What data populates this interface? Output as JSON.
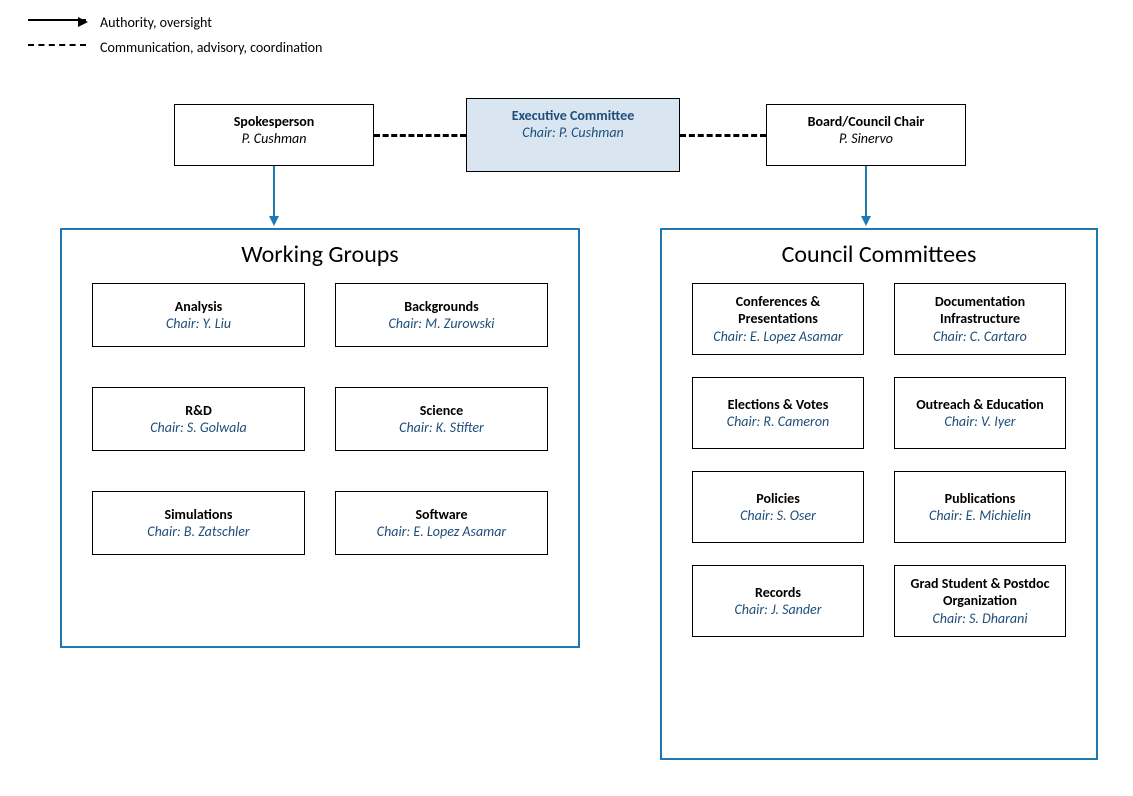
{
  "legend": {
    "solid": "Authority, oversight",
    "dashed": "Communication, advisory, coordination"
  },
  "top": {
    "spokesperson": {
      "title": "Spokesperson",
      "name": "P. Cushman"
    },
    "exec": {
      "title": "Executive Committee",
      "chair_prefix": "Chair:",
      "name": "P. Cushman"
    },
    "board": {
      "title": "Board/Council Chair",
      "name": "P. Sinervo"
    }
  },
  "chair_prefix": "Chair:",
  "working_groups": {
    "title": "Working Groups",
    "items": [
      {
        "title": "Analysis",
        "chair": "Y. Liu"
      },
      {
        "title": "Backgrounds",
        "chair": "M. Zurowski"
      },
      {
        "title": "R&D",
        "chair": "S. Golwala"
      },
      {
        "title": "Science",
        "chair": "K. Stifter"
      },
      {
        "title": "Simulations",
        "chair": "B. Zatschler"
      },
      {
        "title": "Software",
        "chair": "E. Lopez Asamar"
      }
    ]
  },
  "council_committees": {
    "title": "Council Committees",
    "items": [
      {
        "title": "Conferences & Presentations",
        "chair": "E. Lopez Asamar"
      },
      {
        "title": "Documentation Infrastructure",
        "chair": "C. Cartaro"
      },
      {
        "title": "Elections & Votes",
        "chair": "R. Cameron"
      },
      {
        "title": "Outreach & Education",
        "chair": "V. Iyer"
      },
      {
        "title": "Policies",
        "chair": "S. Oser"
      },
      {
        "title": "Publications",
        "chair": "E. Michielin"
      },
      {
        "title": "Records",
        "chair": "J. Sander"
      },
      {
        "title": "Grad Student & Postdoc Organization",
        "chair": "S. Dharani"
      }
    ]
  }
}
